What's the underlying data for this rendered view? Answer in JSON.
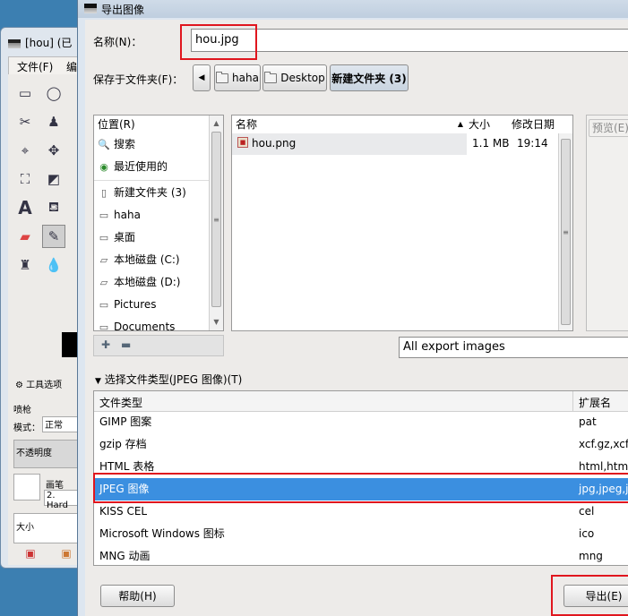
{
  "gimp_window": {
    "title": "[hou] (已",
    "menu": [
      "文件(F)",
      "编"
    ],
    "tool_options_label": "工具选项",
    "tool_name": "喷枪",
    "mode_label": "模式：",
    "mode_value": "正常",
    "opacity_label": "不透明度",
    "brush_label": "画笔",
    "brush_value": "2. Hard",
    "size_label": "大小"
  },
  "dialog": {
    "title": "导出图像",
    "name_label": "名称(N)：",
    "name_value": "hou.jpg",
    "save_in_label": "保存于文件夹(F)：",
    "path": [
      "haha",
      "Desktop",
      "新建文件夹 (3)"
    ],
    "places": {
      "header": "位置(R)",
      "items": [
        {
          "icon": "search-icon",
          "label": "搜索"
        },
        {
          "icon": "recent-icon",
          "label": "最近使用的"
        },
        {
          "icon": "document-icon",
          "label": "新建文件夹 (3)"
        },
        {
          "icon": "folder-icon",
          "label": "haha"
        },
        {
          "icon": "folder-icon",
          "label": "桌面"
        },
        {
          "icon": "drive-icon",
          "label": "本地磁盘 (C:)"
        },
        {
          "icon": "drive-icon",
          "label": "本地磁盘 (D:)"
        },
        {
          "icon": "folder-icon",
          "label": "Pictures"
        },
        {
          "icon": "folder-icon",
          "label": "Documents"
        }
      ]
    },
    "files": {
      "columns": {
        "name": "名称",
        "size": "大小",
        "modified": "修改日期"
      },
      "rows": [
        {
          "name": "hou.png",
          "size": "1.1 MB",
          "modified": "19:14"
        }
      ]
    },
    "preview_label": "预览(E)",
    "filter_value": "All export images",
    "file_type_toggle": "选择文件类型(JPEG 图像)(T)",
    "types": {
      "columns": {
        "type": "文件类型",
        "ext": "扩展名"
      },
      "rows": [
        {
          "type": "GIMP 图案",
          "ext": "pat"
        },
        {
          "type": "gzip 存档",
          "ext": "xcf.gz,xcfgz"
        },
        {
          "type": "HTML 表格",
          "ext": "html,htm"
        },
        {
          "type": "JPEG 图像",
          "ext": "jpg,jpeg,jpe"
        },
        {
          "type": "KISS CEL",
          "ext": "cel"
        },
        {
          "type": "Microsoft Windows 图标",
          "ext": "ico"
        },
        {
          "type": "MNG 动画",
          "ext": "mng"
        }
      ],
      "selected_index": 3
    },
    "help_button": "帮助(H)",
    "export_button": "导出(E)"
  },
  "colors": {
    "selection": "#3b8fe0",
    "highlight_box": "#e0161e",
    "dialog_bg": "#edebe9"
  }
}
